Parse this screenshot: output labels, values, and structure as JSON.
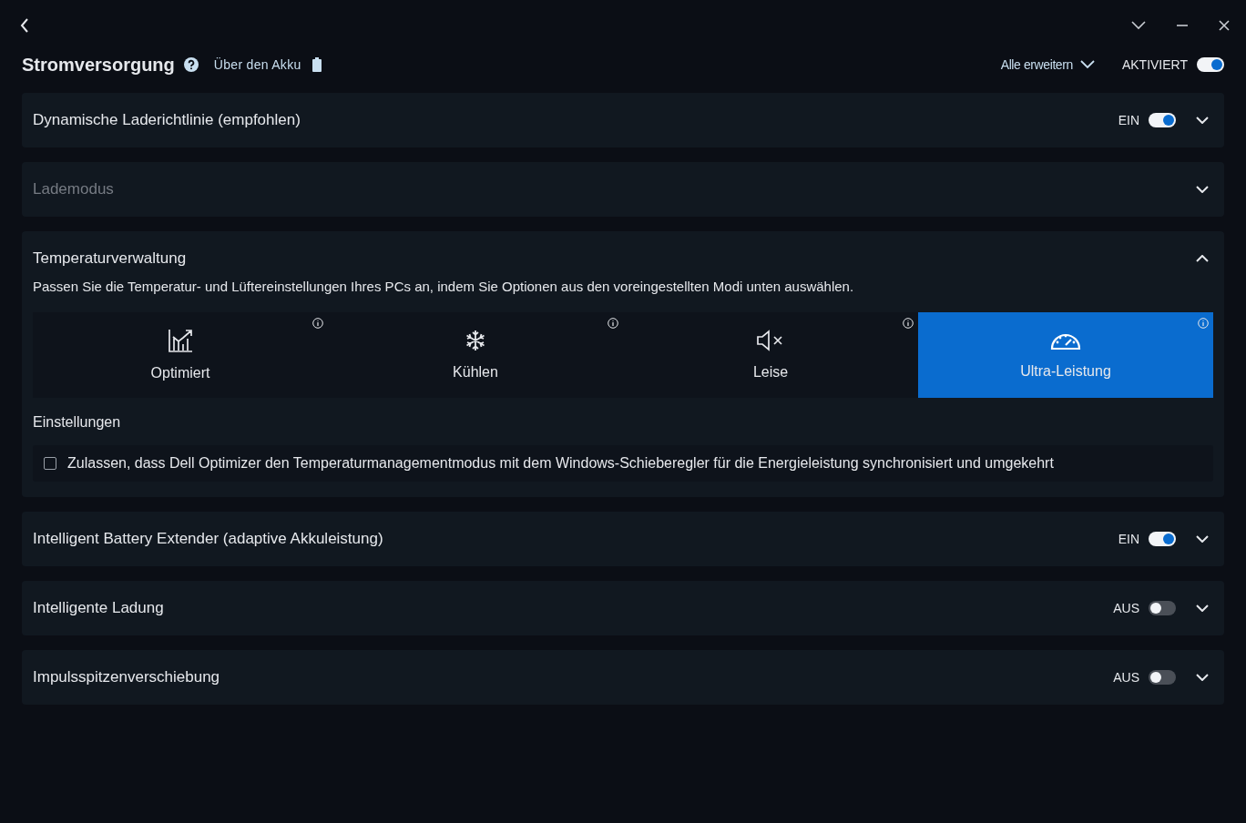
{
  "header": {
    "title": "Stromversorgung",
    "battery_link": "Über den Akku",
    "expand_all": "Alle erweitern",
    "master_toggle": {
      "label": "AKTIVIERT",
      "on": true
    }
  },
  "sections": [
    {
      "title": "Dynamische Laderichtlinie (empfohlen)",
      "disabled": false,
      "expanded": false,
      "toggle": {
        "label": "EIN",
        "on": true
      }
    },
    {
      "title": "Lademodus",
      "disabled": true,
      "expanded": false
    },
    {
      "title": "Temperaturverwaltung",
      "disabled": false,
      "expanded": true,
      "description": "Passen Sie die Temperatur- und Lüftereinstellungen Ihres PCs an, indem Sie Optionen aus den voreingestellten Modi unten auswählen.",
      "modes": [
        {
          "label": "Optimiert",
          "kind": "chart",
          "selected": false
        },
        {
          "label": "Kühlen",
          "kind": "snowflake",
          "selected": false
        },
        {
          "label": "Leise",
          "kind": "mute",
          "selected": false
        },
        {
          "label": "Ultra-Leistung",
          "kind": "gauge",
          "selected": true
        }
      ],
      "settings_label": "Einstellungen",
      "checkbox": {
        "label": "Zulassen, dass Dell Optimizer den Temperaturmanagementmodus mit dem Windows-Schieberegler für die Energieleistung synchronisiert und umgekehrt",
        "checked": false
      }
    },
    {
      "title": "Intelligent Battery Extender (adaptive Akkuleistung)",
      "disabled": false,
      "expanded": false,
      "toggle": {
        "label": "EIN",
        "on": true
      }
    },
    {
      "title": "Intelligente Ladung",
      "disabled": false,
      "expanded": false,
      "toggle": {
        "label": "AUS",
        "on": false
      }
    },
    {
      "title": "Impulsspitzenverschiebung",
      "disabled": false,
      "expanded": false,
      "toggle": {
        "label": "AUS",
        "on": false
      }
    }
  ]
}
